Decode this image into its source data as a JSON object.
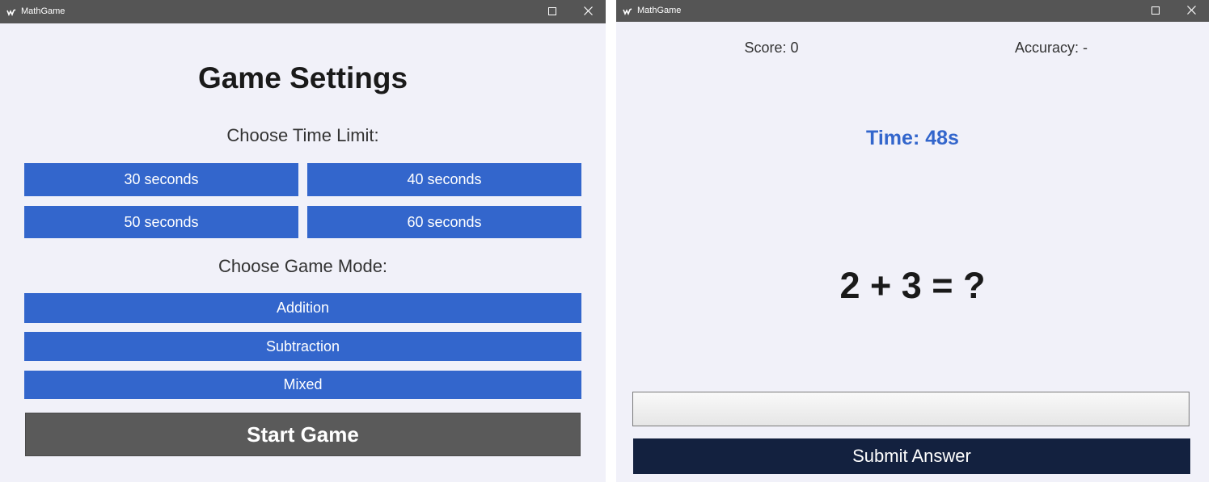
{
  "settings_window": {
    "title": "MathGame",
    "heading": "Game Settings",
    "time_label": "Choose Time Limit:",
    "time_options": [
      "30 seconds",
      "40 seconds",
      "50 seconds",
      "60 seconds"
    ],
    "mode_label": "Choose Game Mode:",
    "mode_options": [
      "Addition",
      "Subtraction",
      "Mixed"
    ],
    "start_label": "Start Game"
  },
  "game_window": {
    "title": "MathGame",
    "score": "Score: 0",
    "accuracy": "Accuracy: -",
    "timer": "Time: 48s",
    "question": "2 + 3 = ?",
    "answer_value": "",
    "submit_label": "Submit Answer"
  },
  "icons": {
    "app": "app-logo-icon",
    "maximize": "maximize-icon",
    "close": "close-icon"
  },
  "colors": {
    "titlebar": "#555555",
    "window_bg": "#f1f1f9",
    "accent_blue": "#3366cc",
    "start_button": "#5a5a5a",
    "submit_button": "#13213f"
  }
}
